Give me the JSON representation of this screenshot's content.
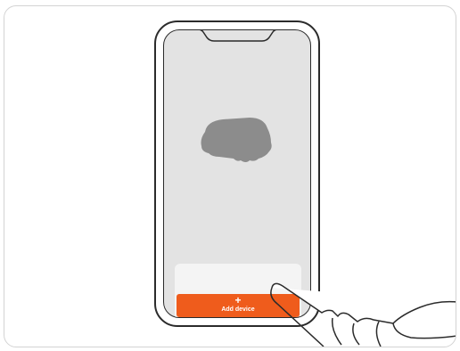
{
  "screen": {
    "add_device_button": {
      "icon": "plus-icon",
      "plus_symbol": "+",
      "label": "Add device"
    },
    "device_illustration": "robotic-mower-icon"
  },
  "colors": {
    "accent": "#ef5c1c",
    "screen_bg": "#e3e3e3",
    "device_silhouette": "#8c8c8c",
    "outline": "#2b2b2b"
  },
  "overlay": {
    "hand": "pointing-hand-icon"
  }
}
